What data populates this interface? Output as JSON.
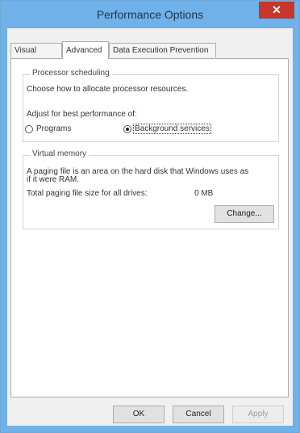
{
  "window": {
    "title": "Performance Options",
    "close_glyph": "✕"
  },
  "tabs": [
    {
      "label": "Visual Effects"
    },
    {
      "label": "Advanced"
    },
    {
      "label": "Data Execution Prevention"
    }
  ],
  "processor": {
    "group_title": "Processor scheduling",
    "description": "Choose how to allocate processor resources.",
    "adjust_label": "Adjust for best performance of:",
    "programs_label": "Programs",
    "background_label": "Background services",
    "selected": "Background services"
  },
  "virtual_memory": {
    "group_title": "Virtual memory",
    "description_line1": "A paging file is an area on the hard disk that Windows uses as",
    "description_line2": "if it were RAM.",
    "total_label": "Total paging file size for all drives:",
    "total_value": "0 MB",
    "change_button": "Change..."
  },
  "footer": {
    "ok": "OK",
    "cancel": "Cancel",
    "apply": "Apply"
  }
}
